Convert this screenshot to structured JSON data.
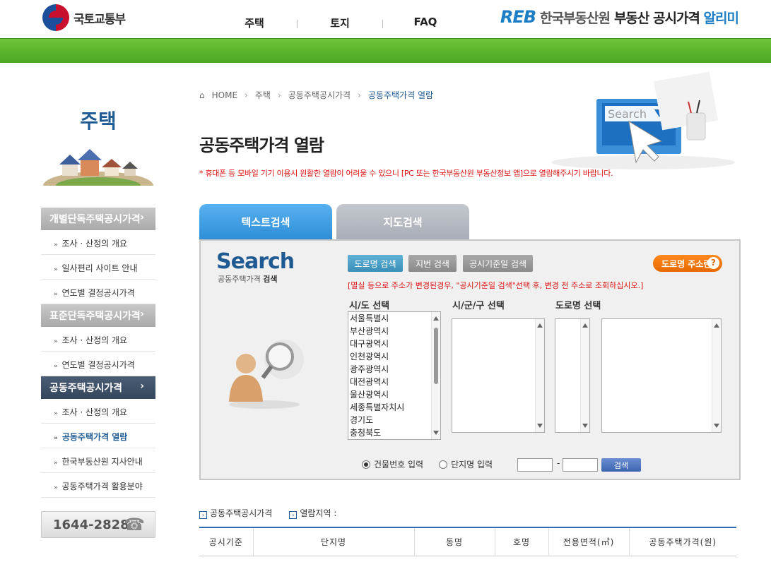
{
  "header": {
    "gov_name": "국토교통부",
    "menu": [
      "주택",
      "토지",
      "FAQ"
    ],
    "reb_mark": "REB",
    "reb_org": "한국부동산원",
    "reb_title_prefix": "부동산 공시가격",
    "reb_title_accent": "알리미"
  },
  "sidebar": {
    "title": "주택",
    "groups": [
      {
        "label": "개별단독주택공시가격",
        "active": false,
        "items": [
          "조사 · 산정의 개요",
          "일사편리 사이트 안내",
          "연도별 결정공시가격"
        ]
      },
      {
        "label": "표준단독주택공시가격",
        "active": false,
        "items": [
          "조사 · 산정의 개요",
          "연도별 결정공시가격"
        ]
      },
      {
        "label": "공동주택공시가격",
        "active": true,
        "items": [
          "조사 · 산정의 개요",
          "공동주택가격 열람",
          "한국부동산원 지사안내",
          "공동주택가격 활용분야"
        ]
      }
    ],
    "current_item": "공동주택가격 열람",
    "phone": "1644-2828"
  },
  "breadcrumb": [
    "HOME",
    "주택",
    "공동주택공시가격",
    "공동주택가격 열람"
  ],
  "page_title": "공동주택가격 열람",
  "notice": "* 휴대폰 등 모바일 기기 이용시 원활한 열람이 어려울 수 있으니 [PC 또는 한국부동산원 부동산정보 앱]으로 열람해주시기 바랍니다.",
  "hero_search_text": "Search",
  "tabs": [
    "텍스트검색",
    "지도검색"
  ],
  "search": {
    "logo": "Search",
    "sub_prefix": "공동주택가격",
    "sub_bold": "검색",
    "mode_buttons": [
      "도로명 검색",
      "지번 검색",
      "공시기준일 검색"
    ],
    "road_addr_button": "도로명 주소란",
    "road_addr_icon": "?",
    "warning": "[멸실 등으로 주소가 변경된경우, \"공시기준일 검색\"선택 후, 변경 전 주소로 조회하십시오.]",
    "col_labels": [
      "시/도 선택",
      "시/군/구 선택",
      "도로명 선택"
    ],
    "sido_options": [
      "서울특별시",
      "부산광역시",
      "대구광역시",
      "인천광역시",
      "광주광역시",
      "대전광역시",
      "울산광역시",
      "세종특별자치시",
      "경기도",
      "충청북도"
    ],
    "radio_building": "건물번호 입력",
    "radio_complex": "단지명 입력",
    "selected_radio": "건물번호 입력",
    "dash": "-",
    "search_button": "검색"
  },
  "results": {
    "label_price": "공동주택공시가격",
    "label_region": "열람지역 :",
    "columns": [
      "공시기준",
      "단지명",
      "동명",
      "호명",
      "전용면적(㎡)",
      "공동주택가격(원)"
    ]
  }
}
